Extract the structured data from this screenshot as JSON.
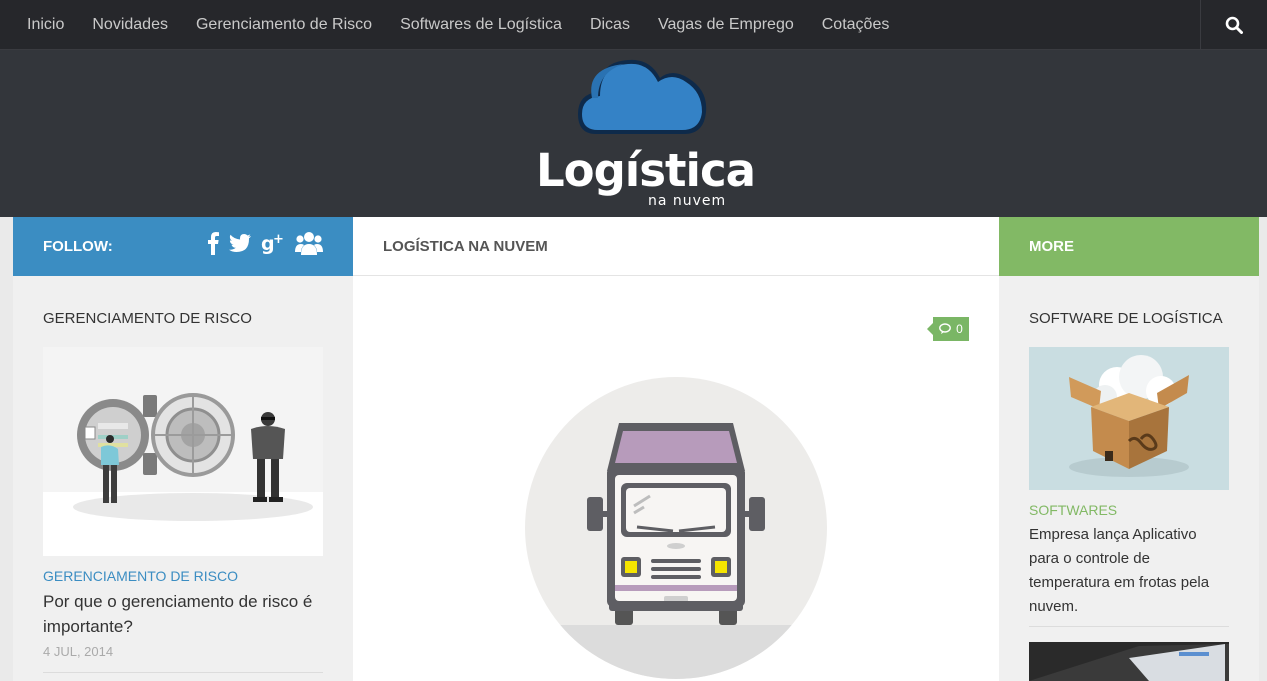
{
  "nav": {
    "items": [
      "Inicio",
      "Novidades",
      "Gerenciamento de Risco",
      "Softwares de Logística",
      "Dicas",
      "Vagas de Emprego",
      "Cotações"
    ],
    "search_icon": "search-icon"
  },
  "header": {
    "logo_title": "Logística",
    "logo_subtitle": "na nuvem"
  },
  "sidebar_left": {
    "follow_label": "FOLLOW:",
    "social_icons": [
      "facebook-icon",
      "twitter-icon",
      "google-plus-icon",
      "group-icon"
    ],
    "widget_title": "GERENCIAMENTO DE RISCO",
    "post": {
      "category": "GERENCIAMENTO DE RISCO",
      "title": "Por que o gerenciamento de risco é importante?",
      "date": "4 JUL, 2014"
    }
  },
  "main": {
    "title": "LOGÍSTICA NA NUVEM",
    "comment_count": "0"
  },
  "sidebar_right": {
    "head_label": "MORE",
    "widget_title": "SOFTWARE DE LOGÍSTICA",
    "post": {
      "category": "SOFTWARES",
      "title": "Empresa lança Aplicativo para o controle de temperatura em frotas pela nuvem."
    }
  },
  "colors": {
    "nav_bg": "#26272b",
    "header_bg": "#33363b",
    "blue_accent": "#3b8dc2",
    "green_accent": "#82b965",
    "comment_badge": "#7ab665"
  }
}
